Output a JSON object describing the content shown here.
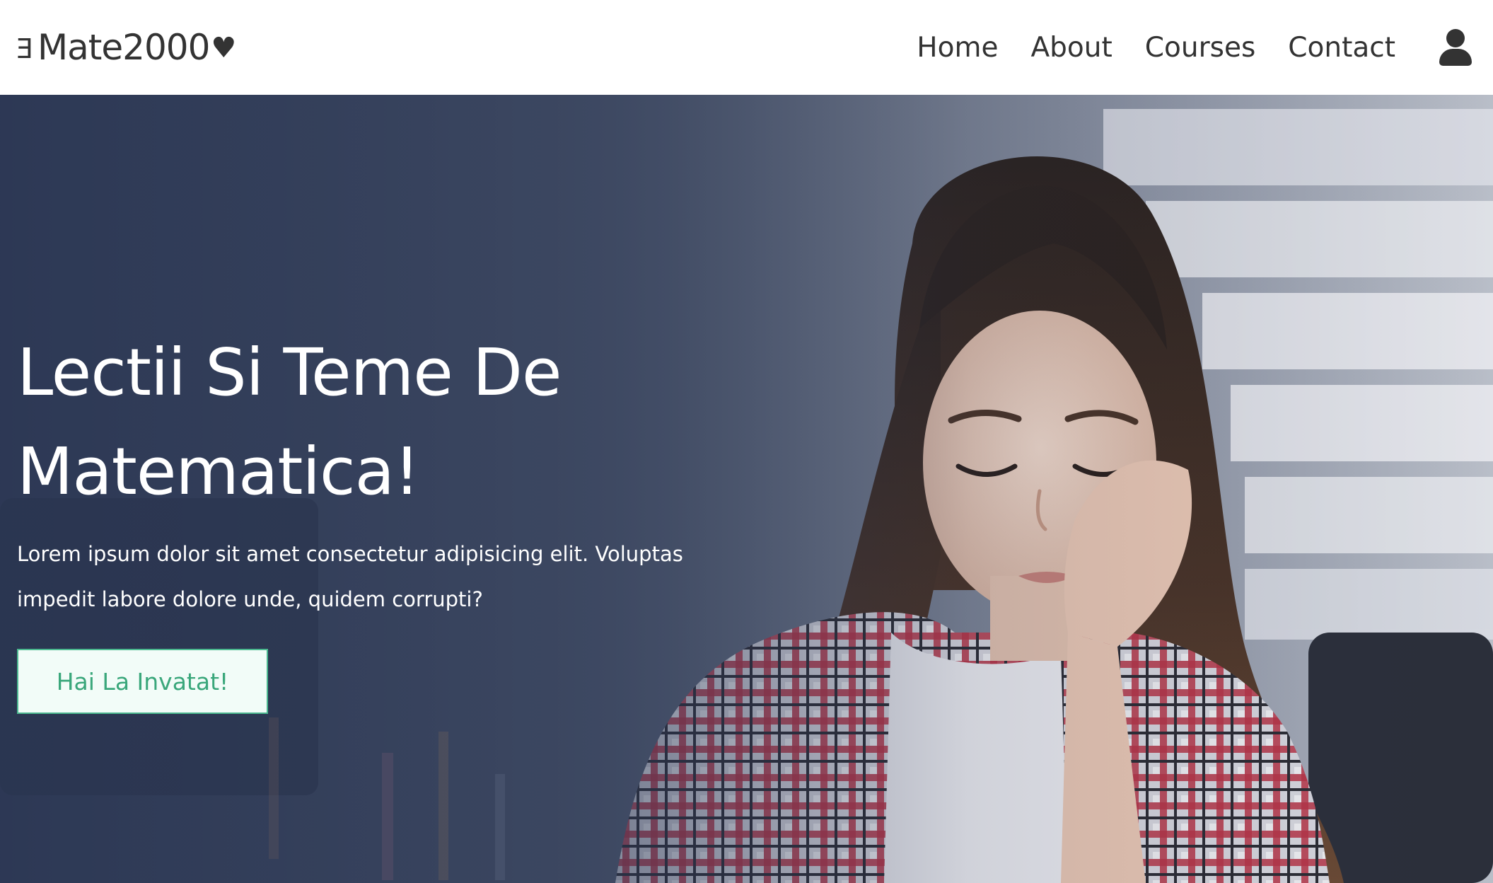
{
  "header": {
    "logo": {
      "prefix_glyph": "E",
      "text": "Mate2000",
      "heart": "♥"
    },
    "nav": [
      {
        "label": "Home"
      },
      {
        "label": "About"
      },
      {
        "label": "Courses"
      },
      {
        "label": "Contact"
      }
    ],
    "user_icon": "user-icon"
  },
  "hero": {
    "title_line1": "Lectii Si Teme De",
    "title_line2": "Matematica!",
    "text_line1": "Lorem ipsum dolor sit amet consectetur adipisicing elit. Voluptas",
    "text_line2": "impedit labore dolore unde, quidem corrupti?",
    "cta_label": "Hai La Invatat!"
  },
  "colors": {
    "accent": "#4cb990",
    "accent_text": "#3aa77b",
    "header_text": "#333333",
    "hero_bg": "#3b4660"
  }
}
